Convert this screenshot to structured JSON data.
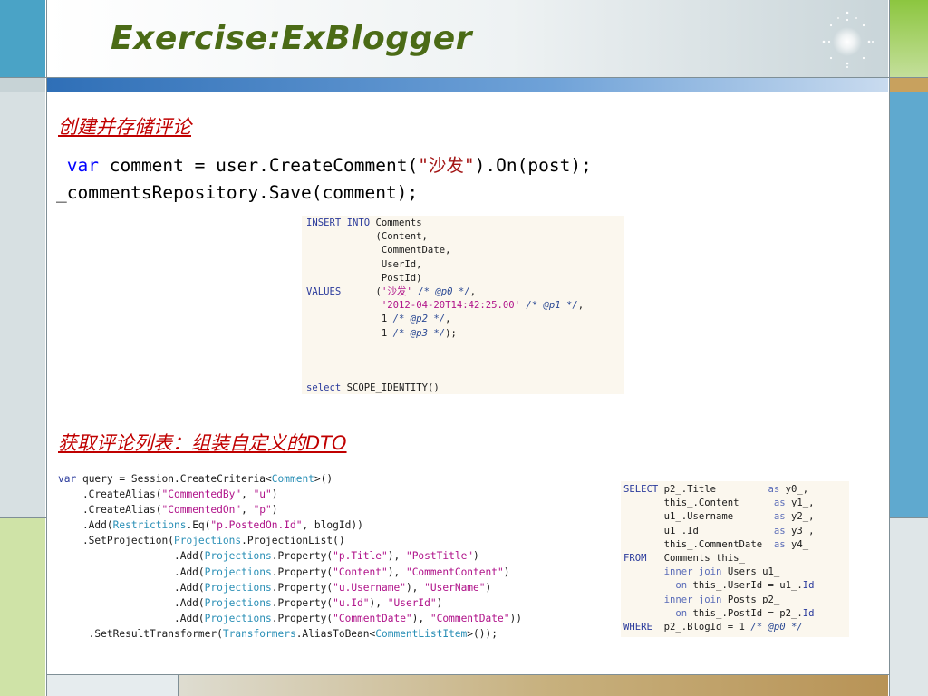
{
  "slide": {
    "title": "Exercise:ExBlogger"
  },
  "section1": {
    "heading": "创建并存储评论",
    "code": {
      "kw_var": "var",
      "line1_a": " comment = user.CreateComment(",
      "line1_str": "\"沙发\"",
      "line1_b": ").On(post);",
      "line2": "_commentsRepository.Save(comment);"
    },
    "sql_insert": [
      [
        {
          "c": "k",
          "t": "INSERT INTO"
        },
        {
          "c": "",
          "t": " Comments"
        }
      ],
      [
        {
          "c": "",
          "t": "            (Content,"
        }
      ],
      [
        {
          "c": "",
          "t": "             CommentDate,"
        }
      ],
      [
        {
          "c": "",
          "t": "             UserId,"
        }
      ],
      [
        {
          "c": "",
          "t": "             PostId)"
        }
      ],
      [
        {
          "c": "k",
          "t": "VALUES"
        },
        {
          "c": "",
          "t": "      ("
        },
        {
          "c": "s",
          "t": "'沙发'"
        },
        {
          "c": "c",
          "t": " /* @p0 */"
        },
        {
          "c": "",
          "t": ","
        }
      ],
      [
        {
          "c": "",
          "t": "             "
        },
        {
          "c": "s",
          "t": "'2012-04-20T14:42:25.00'"
        },
        {
          "c": "c",
          "t": " /* @p1 */"
        },
        {
          "c": "",
          "t": ","
        }
      ],
      [
        {
          "c": "",
          "t": "             1"
        },
        {
          "c": "c",
          "t": " /* @p2 */"
        },
        {
          "c": "",
          "t": ","
        }
      ],
      [
        {
          "c": "",
          "t": "             1"
        },
        {
          "c": "c",
          "t": " /* @p3 */"
        },
        {
          "c": "",
          "t": ");"
        }
      ],
      [
        {
          "c": "",
          "t": ""
        }
      ],
      [
        {
          "c": "",
          "t": ""
        }
      ],
      [
        {
          "c": "",
          "t": ""
        }
      ],
      [
        {
          "c": "k",
          "t": "select"
        },
        {
          "c": "",
          "t": " SCOPE_IDENTITY()"
        }
      ]
    ]
  },
  "section2": {
    "heading_cn": "获取评论列表：组装自定义的",
    "heading_en": "DTO",
    "criteria_code": [
      [
        {
          "c": "k",
          "t": "var"
        },
        {
          "c": "",
          "t": " query = Session.CreateCriteria<"
        },
        {
          "c": "t",
          "t": "Comment"
        },
        {
          "c": "",
          "t": ">()"
        }
      ],
      [
        {
          "c": "",
          "t": "    .CreateAlias("
        },
        {
          "c": "s",
          "t": "\"CommentedBy\""
        },
        {
          "c": "",
          "t": ", "
        },
        {
          "c": "s",
          "t": "\"u\""
        },
        {
          "c": "",
          "t": ")"
        }
      ],
      [
        {
          "c": "",
          "t": "    .CreateAlias("
        },
        {
          "c": "s",
          "t": "\"CommentedOn\""
        },
        {
          "c": "",
          "t": ", "
        },
        {
          "c": "s",
          "t": "\"p\""
        },
        {
          "c": "",
          "t": ")"
        }
      ],
      [
        {
          "c": "",
          "t": "    .Add("
        },
        {
          "c": "t",
          "t": "Restrictions"
        },
        {
          "c": "",
          "t": ".Eq("
        },
        {
          "c": "s",
          "t": "\"p.PostedOn.Id\""
        },
        {
          "c": "",
          "t": ", blogId))"
        }
      ],
      [
        {
          "c": "",
          "t": "    .SetProjection("
        },
        {
          "c": "t",
          "t": "Projections"
        },
        {
          "c": "",
          "t": ".ProjectionList()"
        }
      ],
      [
        {
          "c": "",
          "t": "                   .Add("
        },
        {
          "c": "t",
          "t": "Projections"
        },
        {
          "c": "",
          "t": ".Property("
        },
        {
          "c": "s",
          "t": "\"p.Title\""
        },
        {
          "c": "",
          "t": "), "
        },
        {
          "c": "s",
          "t": "\"PostTitle\""
        },
        {
          "c": "",
          "t": ")"
        }
      ],
      [
        {
          "c": "",
          "t": "                   .Add("
        },
        {
          "c": "t",
          "t": "Projections"
        },
        {
          "c": "",
          "t": ".Property("
        },
        {
          "c": "s",
          "t": "\"Content\""
        },
        {
          "c": "",
          "t": "), "
        },
        {
          "c": "s",
          "t": "\"CommentContent\""
        },
        {
          "c": "",
          "t": ")"
        }
      ],
      [
        {
          "c": "",
          "t": "                   .Add("
        },
        {
          "c": "t",
          "t": "Projections"
        },
        {
          "c": "",
          "t": ".Property("
        },
        {
          "c": "s",
          "t": "\"u.Username\""
        },
        {
          "c": "",
          "t": "), "
        },
        {
          "c": "s",
          "t": "\"UserName\""
        },
        {
          "c": "",
          "t": ")"
        }
      ],
      [
        {
          "c": "",
          "t": "                   .Add("
        },
        {
          "c": "t",
          "t": "Projections"
        },
        {
          "c": "",
          "t": ".Property("
        },
        {
          "c": "s",
          "t": "\"u.Id\""
        },
        {
          "c": "",
          "t": "), "
        },
        {
          "c": "s",
          "t": "\"UserId\""
        },
        {
          "c": "",
          "t": ")"
        }
      ],
      [
        {
          "c": "",
          "t": "                   .Add("
        },
        {
          "c": "t",
          "t": "Projections"
        },
        {
          "c": "",
          "t": ".Property("
        },
        {
          "c": "s",
          "t": "\"CommentDate\""
        },
        {
          "c": "",
          "t": "), "
        },
        {
          "c": "s",
          "t": "\"CommentDate\""
        },
        {
          "c": "",
          "t": "))"
        }
      ],
      [
        {
          "c": "",
          "t": "     .SetResultTransformer("
        },
        {
          "c": "t",
          "t": "Transformers"
        },
        {
          "c": "",
          "t": ".AliasToBean<"
        },
        {
          "c": "t",
          "t": "CommentListItem"
        },
        {
          "c": "",
          "t": ">());"
        }
      ]
    ],
    "sql_select": [
      [
        {
          "c": "k",
          "t": "SELECT"
        },
        {
          "c": "",
          "t": " p2_.Title         "
        },
        {
          "c": "v",
          "t": "as"
        },
        {
          "c": "",
          "t": " y0_,"
        }
      ],
      [
        {
          "c": "",
          "t": "       this_.Content      "
        },
        {
          "c": "v",
          "t": "as"
        },
        {
          "c": "",
          "t": " y1_,"
        }
      ],
      [
        {
          "c": "",
          "t": "       u1_.Username       "
        },
        {
          "c": "v",
          "t": "as"
        },
        {
          "c": "",
          "t": " y2_,"
        }
      ],
      [
        {
          "c": "",
          "t": "       u1_.Id             "
        },
        {
          "c": "v",
          "t": "as"
        },
        {
          "c": "",
          "t": " y3_,"
        }
      ],
      [
        {
          "c": "",
          "t": "       this_.CommentDate  "
        },
        {
          "c": "v",
          "t": "as"
        },
        {
          "c": "",
          "t": " y4_"
        }
      ],
      [
        {
          "c": "k",
          "t": "FROM"
        },
        {
          "c": "",
          "t": "   Comments this_"
        }
      ],
      [
        {
          "c": "",
          "t": "       "
        },
        {
          "c": "v",
          "t": "inner join"
        },
        {
          "c": "",
          "t": " Users u1_"
        }
      ],
      [
        {
          "c": "",
          "t": "         "
        },
        {
          "c": "v",
          "t": "on"
        },
        {
          "c": "",
          "t": " this_.UserId = u1_."
        },
        {
          "c": "k",
          "t": "Id"
        }
      ],
      [
        {
          "c": "",
          "t": "       "
        },
        {
          "c": "v",
          "t": "inner join"
        },
        {
          "c": "",
          "t": " Posts p2_"
        }
      ],
      [
        {
          "c": "",
          "t": "         "
        },
        {
          "c": "v",
          "t": "on"
        },
        {
          "c": "",
          "t": " this_.PostId = p2_."
        },
        {
          "c": "k",
          "t": "Id"
        }
      ],
      [
        {
          "c": "k",
          "t": "WHERE"
        },
        {
          "c": "",
          "t": "  p2_.BlogId = 1"
        },
        {
          "c": "c",
          "t": " /* @p0 */"
        }
      ]
    ]
  }
}
